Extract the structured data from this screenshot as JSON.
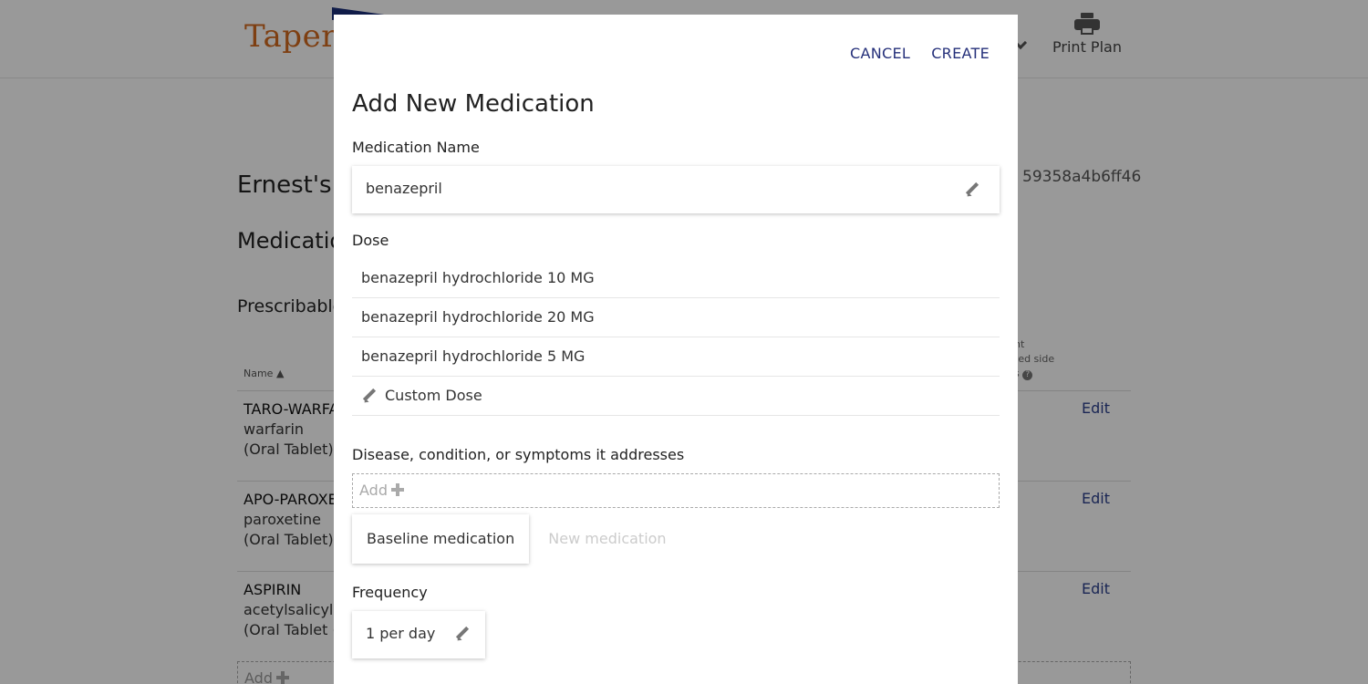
{
  "background": {
    "logo": "Taper",
    "print_plan": "Print Plan",
    "patient_title": "Ernest's T",
    "plan_id": "59358a4b6ff46",
    "medications_heading": "Medicatio",
    "prescribable_heading": "Prescribable",
    "column_name": "Name ▲",
    "column_side_effects": [
      "nt",
      "ted side",
      "s"
    ],
    "rows": [
      {
        "brand": "TARO-WARFA",
        "generic": "warfarin",
        "form": "(Oral Tablet)",
        "edit": "Edit"
      },
      {
        "brand": "APO-PAROXE",
        "generic": "paroxetine",
        "form": "(Oral Tablet)",
        "edit": "Edit"
      },
      {
        "brand": "ASPIRIN",
        "generic": "acetylsalicylic",
        "form": "(Oral Tablet (",
        "edit": "Edit"
      }
    ],
    "add_label": "Add"
  },
  "modal": {
    "cancel_label": "CANCEL",
    "create_label": "CREATE",
    "title": "Add New Medication",
    "medication_name_label": "Medication Name",
    "medication_name_value": "benazepril",
    "dose_label": "Dose",
    "doses": [
      "benazepril hydrochloride 10 MG",
      "benazepril hydrochloride 20 MG",
      "benazepril hydrochloride 5 MG"
    ],
    "custom_dose_label": "Custom Dose",
    "disease_label": "Disease, condition, or symptoms it addresses",
    "disease_add_label": "Add",
    "type_options": {
      "selected": "Baseline medication",
      "other": "New medication"
    },
    "frequency_label": "Frequency",
    "frequency_value": "1 per day"
  },
  "colors": {
    "link": "#25307a",
    "logo": "#d26a1e",
    "overlay": "rgba(0,0,0,0.4)"
  }
}
